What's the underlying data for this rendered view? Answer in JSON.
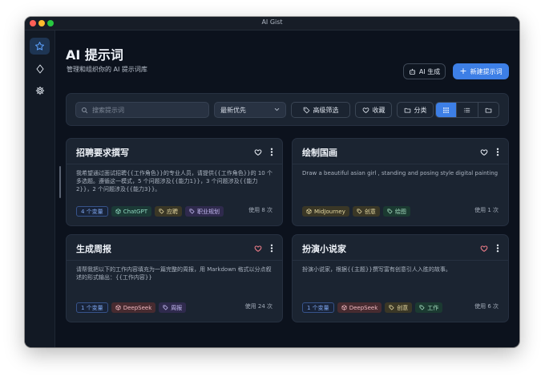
{
  "window": {
    "title": "AI Gist"
  },
  "colors": {
    "accent": "#3d7fe6",
    "favorite": "#f07e8a"
  },
  "sidebar": {
    "items": [
      {
        "icon": "star-icon",
        "active": true
      },
      {
        "icon": "diamond-icon",
        "active": false
      },
      {
        "icon": "gear-icon",
        "active": false
      }
    ]
  },
  "header": {
    "title": "AI 提示词",
    "subtitle": "管理和组织你的 AI 提示词库",
    "generate_label": "AI 生成",
    "new_label": "新建提示词"
  },
  "filters": {
    "search_placeholder": "搜索提示词",
    "sort_value": "最新优先",
    "advanced_label": "高级筛选",
    "favorites_label": "收藏",
    "category_label": "分类",
    "view_modes": [
      "grid",
      "list",
      "folder"
    ],
    "active_view": "grid"
  },
  "cards": [
    {
      "title": "招聘要求撰写",
      "body": "我希望通过面试招聘{{工作角色}}的专业人员，请提供{{工作角色}}的 10 个多选题。遵循这一模式，5 个问题涉及{{能力1}}，3 个问题涉及{{能力2}}，2 个问题涉及{{能力3}}。",
      "variables": "4 个变量",
      "model": "ChatGPT",
      "tags": [
        {
          "label": "应聘",
          "style": "cat-yellow"
        },
        {
          "label": "职业规划",
          "style": "cat-purple"
        }
      ],
      "usage": "使用 8 次",
      "favorite": false
    },
    {
      "title": "绘制国画",
      "body": "Draw a beautiful asian girl , standing and posing style digital painting",
      "variables": "",
      "model": "MidJourney",
      "tags": [
        {
          "label": "创意",
          "style": "cat-yellow"
        },
        {
          "label": "绘图",
          "style": "cat-green"
        }
      ],
      "usage": "使用 1 次",
      "favorite": false
    },
    {
      "title": "生成周报",
      "body": "请帮我把以下的工作内容填充为一篇完整的周报，用 Markdown 格式以分点叙述的形式输出：{{工作内容}}",
      "variables": "1 个变量",
      "model": "DeepSeek",
      "tags": [
        {
          "label": "周报",
          "style": "cat-purple"
        }
      ],
      "usage": "使用 24 次",
      "favorite": true
    },
    {
      "title": "扮演小说家",
      "body": "扮演小说家，根据{{主题}}撰写富有创意引人入胜的故事。",
      "variables": "1 个变量",
      "model": "DeepSeek",
      "tags": [
        {
          "label": "创意",
          "style": "cat-yellow"
        },
        {
          "label": "工作",
          "style": "cat-green"
        }
      ],
      "usage": "使用 6 次",
      "favorite": true
    }
  ]
}
